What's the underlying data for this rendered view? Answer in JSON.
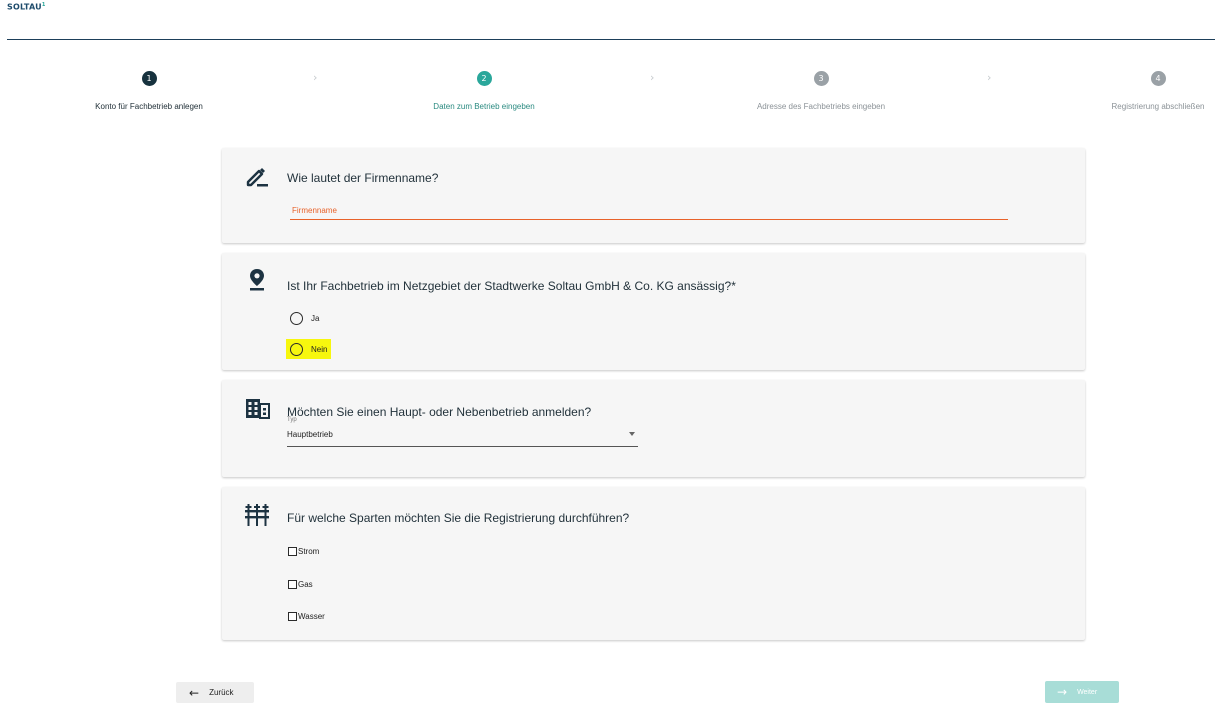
{
  "brand": {
    "logo_text": "SOLTAU",
    "logo_mark": "1"
  },
  "stepper": {
    "steps": [
      {
        "number": "1",
        "label": "Konto für Fachbetrieb anlegen",
        "state": "done"
      },
      {
        "number": "2",
        "label": "Daten zum Betrieb eingeben",
        "state": "active"
      },
      {
        "number": "3",
        "label": "Adresse des Fachbetriebs eingeben",
        "state": "todo"
      },
      {
        "number": "4",
        "label": "Registrierung abschließen",
        "state": "todo"
      }
    ],
    "separator": "›"
  },
  "company": {
    "question": "Wie lautet der Firmenname?",
    "placeholder": "Firmenname"
  },
  "location": {
    "question": "Ist Ihr Fachbetrieb im Netzgebiet der Stadtwerke Soltau GmbH & Co. KG ansässig?*",
    "options": [
      {
        "label": "Ja",
        "checked": false
      },
      {
        "label": "Nein",
        "checked": false,
        "highlighted": true
      }
    ]
  },
  "branch": {
    "question": "Möchten Sie einen Haupt- oder Nebenbetrieb anmelden?",
    "select_label": "Typ",
    "select_value": "Hauptbetrieb"
  },
  "divisions": {
    "question": "Für welche Sparten möchten Sie die Registrierung durchführen?",
    "options": [
      {
        "label": "Strom",
        "checked": false
      },
      {
        "label": "Gas",
        "checked": false
      },
      {
        "label": "Wasser",
        "checked": false
      }
    ]
  },
  "footer": {
    "back_label": "Zurück",
    "next_label": "Weiter",
    "next_enabled": false
  },
  "colors": {
    "accent": "#2aa79b",
    "error": "#e8622a",
    "highlight": "#f7f70e",
    "dark": "#17323e"
  },
  "icons": {
    "company": "pencil-icon",
    "location": "location-pin-icon",
    "branch": "building-icon",
    "divisions": "utility-pylons-icon"
  }
}
